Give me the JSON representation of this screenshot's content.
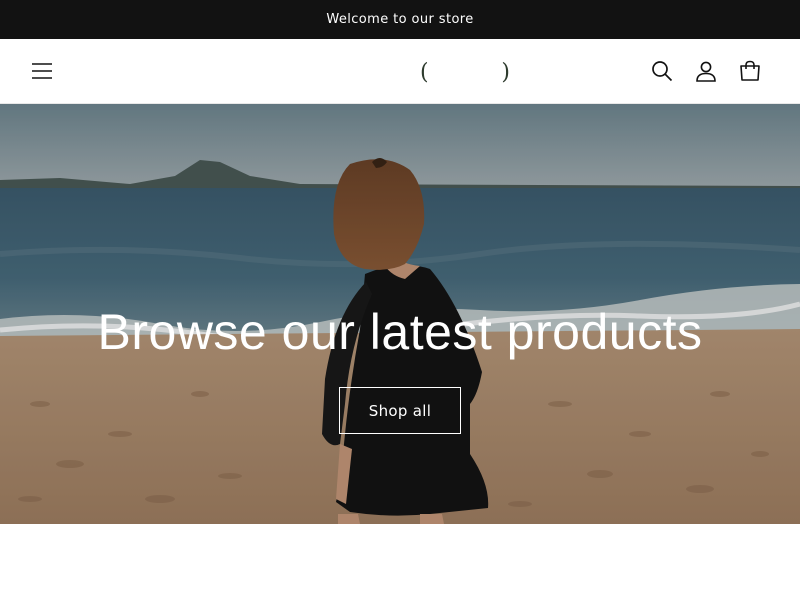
{
  "announcement": {
    "text": "Welcome to our store"
  },
  "header": {
    "logo": {
      "left": "(",
      "right": ")"
    },
    "icons": {
      "menu": "hamburger-menu-icon",
      "search": "search-icon",
      "account": "account-icon",
      "cart": "cart-icon"
    }
  },
  "hero": {
    "heading": "Browse our latest products",
    "button_label": "Shop all"
  },
  "colors": {
    "announcement_bg": "#121212",
    "text_dark": "#121212",
    "white": "#ffffff"
  }
}
